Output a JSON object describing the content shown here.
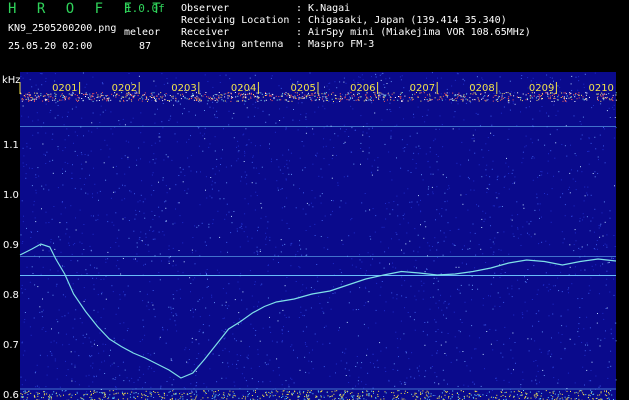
{
  "header": {
    "app_title": "H R O F F T",
    "version": "1.0.0f",
    "filename": "KN9_2505200200.png",
    "mode": "meleor",
    "datetime": "25.05.20 02:00",
    "count": "87"
  },
  "info": [
    {
      "key": "Observer",
      "value": ": K.Nagai"
    },
    {
      "key": "Receiving Location",
      "value": ": Chigasaki, Japan (139.414 35.340)"
    },
    {
      "key": "Receiver",
      "value": ": AirSpy mini (Miakejima VOR 108.65MHz)"
    },
    {
      "key": "Receiving antenna",
      "value": ": Maspro FM-3"
    }
  ],
  "colors": {
    "background_blue": "#0a0a8c",
    "trace": "#7fe0e8",
    "time_labels": "#f2e24a",
    "axis_text": "#ffffff",
    "app_title": "#2fd35a"
  },
  "chart_data": {
    "type": "line",
    "ylabel": "kHz",
    "ylim": [
      0.6,
      1.2
    ],
    "yticks": [
      "1.1",
      "1.0",
      "0.9",
      "0.8",
      "0.7",
      "0.6"
    ],
    "ytick_values": [
      1.1,
      1.0,
      0.9,
      0.8,
      0.7,
      0.6
    ],
    "time_labels": [
      "0201",
      "0202",
      "0203",
      "0204",
      "0205",
      "0206",
      "0207",
      "0208",
      "0209",
      "0210"
    ],
    "xlim": [
      0,
      10
    ],
    "horizontal_lines_khz": [
      0.837,
      0.875,
      0.61,
      1.135
    ],
    "series": [
      {
        "x": [
          0,
          0.2,
          0.35,
          0.5,
          0.6,
          0.75,
          0.9,
          1.1,
          1.3,
          1.5,
          1.7,
          1.9,
          2.1,
          2.3,
          2.5,
          2.7,
          2.9,
          3.1,
          3.3,
          3.5,
          3.7,
          3.9,
          4.1,
          4.3,
          4.6,
          4.9,
          5.2,
          5.5,
          5.8,
          6.1,
          6.4,
          6.7,
          7.0,
          7.3,
          7.6,
          7.9,
          8.2,
          8.5,
          8.8,
          9.1,
          9.4,
          9.7,
          10.0
        ],
        "y": [
          0.878,
          0.89,
          0.9,
          0.894,
          0.87,
          0.84,
          0.8,
          0.765,
          0.735,
          0.71,
          0.695,
          0.682,
          0.672,
          0.66,
          0.648,
          0.632,
          0.642,
          0.67,
          0.7,
          0.73,
          0.745,
          0.762,
          0.775,
          0.784,
          0.79,
          0.8,
          0.806,
          0.818,
          0.83,
          0.838,
          0.845,
          0.842,
          0.838,
          0.84,
          0.845,
          0.852,
          0.862,
          0.868,
          0.865,
          0.858,
          0.865,
          0.87,
          0.866
        ]
      }
    ]
  }
}
